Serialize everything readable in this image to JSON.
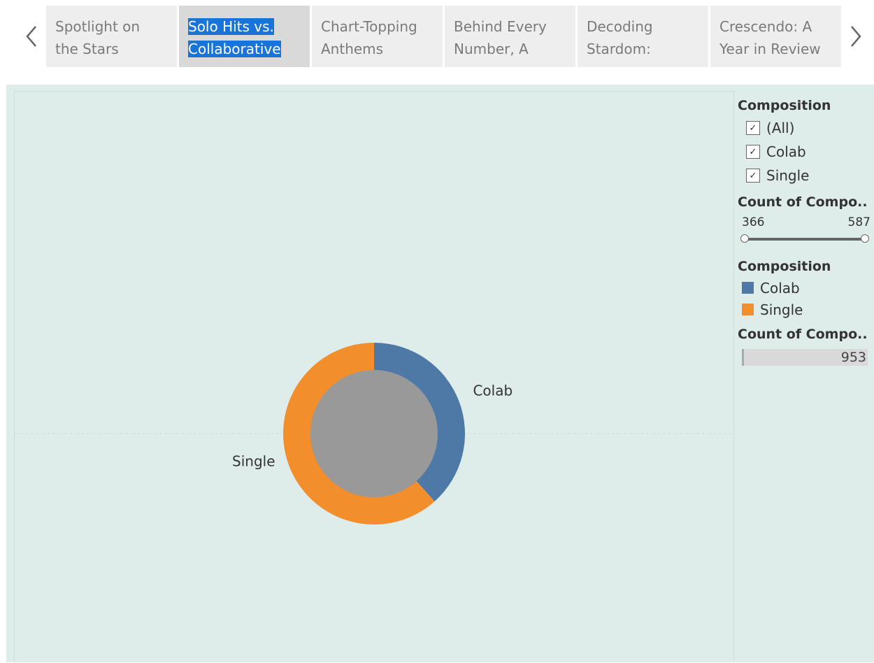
{
  "story": {
    "tabs": [
      {
        "label": "Spotlight on the Stars",
        "active": false
      },
      {
        "label": "Solo Hits vs. Collaborative",
        "active": true
      },
      {
        "label": "Chart-Topping Anthems",
        "active": false
      },
      {
        "label": "Behind Every Number, A",
        "active": false
      },
      {
        "label": "Decoding Stardom:",
        "active": false
      },
      {
        "label": "Crescendo: A Year in Review",
        "active": false
      }
    ],
    "prev_icon": "chevron-left-icon",
    "next_icon": "chevron-right-icon"
  },
  "filter": {
    "title": "Composition",
    "items": [
      {
        "label": "(All)",
        "checked": true
      },
      {
        "label": "Colab",
        "checked": true
      },
      {
        "label": "Single",
        "checked": true
      }
    ]
  },
  "range_filter": {
    "title": "Count of Compo..",
    "min": "366",
    "max": "587"
  },
  "color_legend": {
    "title": "Composition",
    "items": [
      {
        "label": "Colab",
        "color": "#4e79a7"
      },
      {
        "label": "Single",
        "color": "#f28e2b"
      }
    ]
  },
  "size_legend": {
    "title": "Count of Compo..",
    "value": "953"
  },
  "colors": {
    "dashboard_bg": "#deedea",
    "active_tab_highlight": "#1a73d6",
    "donut_hole": "#999999"
  },
  "chart_data": {
    "type": "pie",
    "style": "donut",
    "categories": [
      "Colab",
      "Single"
    ],
    "values": [
      366,
      587
    ],
    "colors": [
      "#4e79a7",
      "#f28e2b"
    ],
    "labels": [
      "Colab",
      "Single"
    ],
    "total": 953
  }
}
